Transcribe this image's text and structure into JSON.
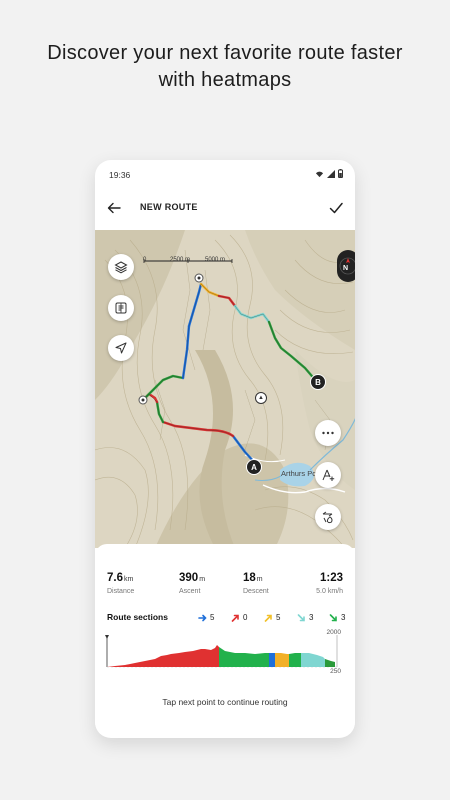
{
  "headline": {
    "line1": "Discover your next favorite route faster",
    "line2": "with heatmaps"
  },
  "status": {
    "time": "19:36"
  },
  "appbar": {
    "title": "NEW ROUTE"
  },
  "map": {
    "scale_label_1": "0",
    "scale_label_2": "2500 m",
    "scale_label_3": "5000 m",
    "compass_label": "N",
    "place_label": "Arthurs Point",
    "marker_a": "A",
    "marker_b": "B",
    "buttons": [
      "layers-icon",
      "route-planner-icon",
      "location-arrow-icon",
      "more-icon",
      "add-waypoint-icon",
      "heatmap-icon"
    ]
  },
  "stats": {
    "distance": {
      "value": "7.6",
      "unit": "km",
      "label": "Distance"
    },
    "ascent": {
      "value": "390",
      "unit": "m",
      "label": "Ascent"
    },
    "descent": {
      "value": "18",
      "unit": "m",
      "label": "Descent"
    },
    "duration": {
      "value": "1:23",
      "label": "5.0 km/h"
    }
  },
  "route_sections": {
    "title": "Route sections",
    "items": [
      {
        "icon": "arrow-right-icon",
        "color": "#1e6fd9",
        "count": "5"
      },
      {
        "icon": "arrow-up-right-icon",
        "color": "#e03131",
        "count": "0"
      },
      {
        "icon": "arrow-up-right-icon",
        "color": "#f2c028",
        "count": "5"
      },
      {
        "icon": "arrow-down-right-icon",
        "color": "#7fd6d1",
        "count": "3"
      },
      {
        "icon": "arrow-down-right-icon",
        "color": "#22b14c",
        "count": "3"
      }
    ]
  },
  "profile": {
    "max_label": "2000",
    "min_label": "250"
  },
  "hint": "Tap next point to continue routing",
  "colors": {
    "blue": "#1e6fd9",
    "red": "#d83030",
    "yellow": "#f2b028",
    "teal": "#7fd6d1",
    "green": "#2a9a3a"
  }
}
